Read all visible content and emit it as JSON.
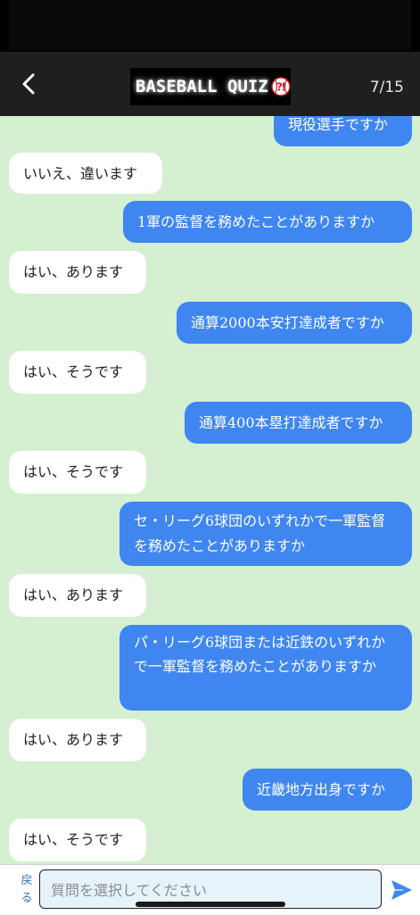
{
  "header": {
    "title": "BASEBALL QUIZ",
    "progress": "7/15"
  },
  "messages": [
    {
      "side": "sent",
      "text": "現役選手ですか"
    },
    {
      "side": "recv",
      "text": "いいえ、違います"
    },
    {
      "side": "sent",
      "text": "1軍の監督を務めたことがありますか"
    },
    {
      "side": "recv",
      "text": "はい、あります"
    },
    {
      "side": "sent",
      "text": "通算2000本安打達成者ですか"
    },
    {
      "side": "recv",
      "text": "はい、そうです"
    },
    {
      "side": "sent",
      "text": "通算400本塁打達成者ですか"
    },
    {
      "side": "recv",
      "text": "はい、そうです"
    },
    {
      "side": "sent",
      "text": "セ・リーグ6球団のいずれかで一軍監督を務めたことがありますか"
    },
    {
      "side": "recv",
      "text": "はい、あります"
    },
    {
      "side": "sent",
      "text": "パ・リーグ6球団または近鉄のいずれかで一軍監督を務めたことがありますか"
    },
    {
      "side": "recv",
      "text": "はい、あります"
    },
    {
      "side": "sent",
      "text": "近畿地方出身ですか"
    },
    {
      "side": "recv",
      "text": "はい、そうです"
    }
  ],
  "input": {
    "back_label": "戻る",
    "placeholder": "質問を選択してください"
  },
  "colors": {
    "sent_bubble": "#3f86f0",
    "recv_bubble": "#ffffff",
    "chat_background": "#d5efd1",
    "header_background": "#1f1f1f"
  }
}
